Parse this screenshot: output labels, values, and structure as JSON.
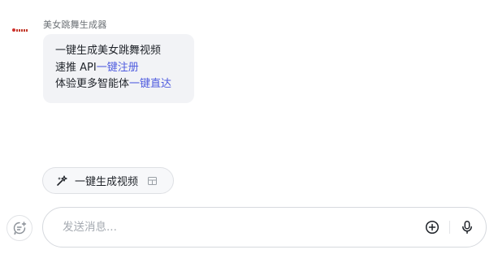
{
  "bot": {
    "name": "美女跳舞生成器",
    "avatar_icon": "app-logo-icon"
  },
  "message": {
    "line1": "一键生成美女跳舞视频",
    "line2_prefix": "速推 API",
    "line2_link": "一键注册",
    "line3_prefix": "体验更多智能体",
    "line3_link": "一键直达"
  },
  "suggestion": {
    "label": "一键生成视频",
    "icon": "sparkle-wand-icon",
    "trailing_icon": "table-grid-icon"
  },
  "composer": {
    "placeholder": "发送消息...",
    "new_chat_icon": "new-chat-icon",
    "add_icon": "plus-circle-icon",
    "mic_icon": "microphone-icon"
  },
  "colors": {
    "link": "#4e5bdf",
    "bubble_bg": "#f2f3f6",
    "border": "#d6d9de"
  }
}
